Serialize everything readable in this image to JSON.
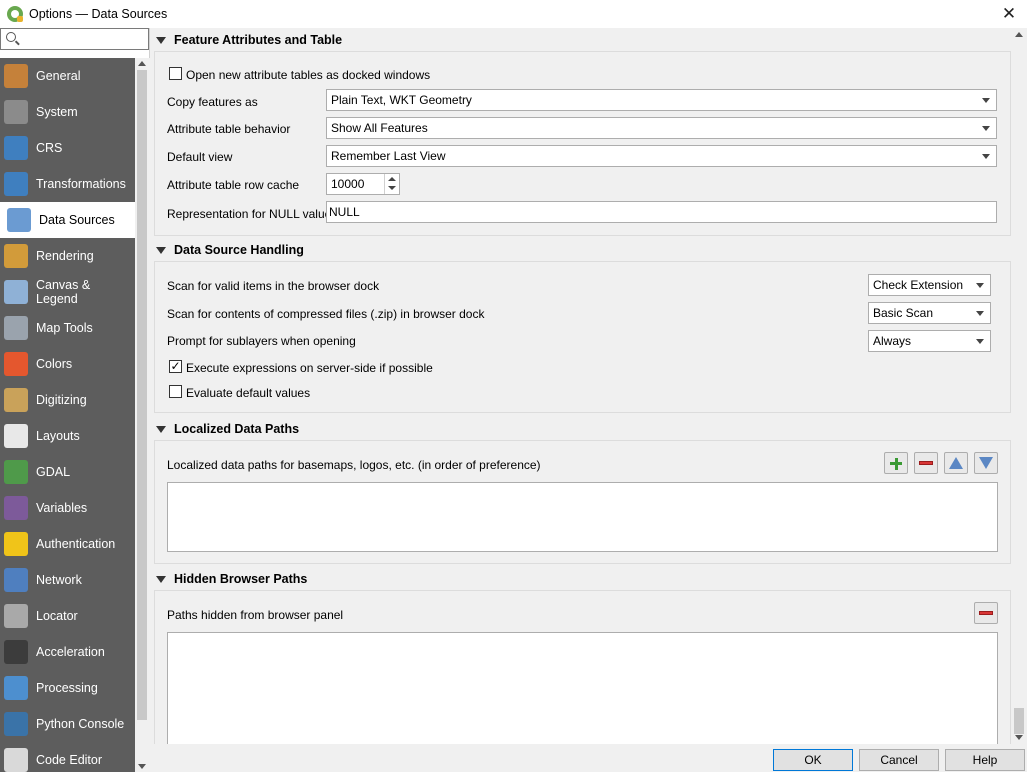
{
  "window": {
    "title": "Options — Data Sources",
    "close_glyph": "✕"
  },
  "search": {
    "value": "",
    "placeholder": ""
  },
  "sidebar": {
    "items": [
      {
        "label": "General",
        "icon": "general-icon",
        "color": "#c5813a"
      },
      {
        "label": "System",
        "icon": "system-icon",
        "color": "#8b8b8b"
      },
      {
        "label": "CRS",
        "icon": "crs-icon",
        "color": "#3f7fbf"
      },
      {
        "label": "Transformations",
        "icon": "transformations-icon",
        "color": "#3f7fbf"
      },
      {
        "label": "Data Sources",
        "icon": "data-sources-icon",
        "color": "#6b9bd2",
        "active": true
      },
      {
        "label": "Rendering",
        "icon": "rendering-icon",
        "color": "#d29b3a"
      },
      {
        "label": "Canvas & Legend",
        "icon": "canvas-legend-icon",
        "color": "#8fb1d6"
      },
      {
        "label": "Map Tools",
        "icon": "map-tools-icon",
        "color": "#9aa3ad"
      },
      {
        "label": "Colors",
        "icon": "colors-icon",
        "color": "#e4572e"
      },
      {
        "label": "Digitizing",
        "icon": "digitizing-icon",
        "color": "#c9a25a"
      },
      {
        "label": "Layouts",
        "icon": "layouts-icon",
        "color": "#e8e8e8"
      },
      {
        "label": "GDAL",
        "icon": "gdal-icon",
        "color": "#4f9a4a"
      },
      {
        "label": "Variables",
        "icon": "variables-icon",
        "color": "#7d5a9a"
      },
      {
        "label": "Authentication",
        "icon": "authentication-icon",
        "color": "#f0c419"
      },
      {
        "label": "Network",
        "icon": "network-icon",
        "color": "#4f7fbf"
      },
      {
        "label": "Locator",
        "icon": "locator-icon",
        "color": "#a9a9a9"
      },
      {
        "label": "Acceleration",
        "icon": "acceleration-icon",
        "color": "#3c3c3c"
      },
      {
        "label": "Processing",
        "icon": "processing-icon",
        "color": "#4d8fcf"
      },
      {
        "label": "Python Console",
        "icon": "python-console-icon",
        "color": "#3a73a8"
      },
      {
        "label": "Code Editor",
        "icon": "code-editor-icon",
        "color": "#d9d9d9"
      }
    ]
  },
  "feature_attributes": {
    "header": "Feature Attributes and Table",
    "open_docked_label": "Open new attribute tables as docked windows",
    "copy_features_label": "Copy features as",
    "copy_features_value": "Plain Text, WKT Geometry",
    "table_behavior_label": "Attribute table behavior",
    "table_behavior_value": "Show All Features",
    "default_view_label": "Default view",
    "default_view_value": "Remember Last View",
    "row_cache_label": "Attribute table row cache",
    "row_cache_value": "10000",
    "null_repr_label": "Representation for NULL values",
    "null_repr_value": "NULL"
  },
  "data_source_handling": {
    "header": "Data Source Handling",
    "scan_valid_label": "Scan for valid items in the browser dock",
    "scan_valid_value": "Check Extension",
    "scan_zip_label": "Scan for contents of compressed files (.zip) in browser dock",
    "scan_zip_value": "Basic Scan",
    "prompt_sublayers_label": "Prompt for sublayers when opening",
    "prompt_sublayers_value": "Always",
    "server_side_label": "Execute expressions on server-side if possible",
    "server_side_checked": "✓",
    "default_values_label": "Evaluate default values"
  },
  "localized_paths": {
    "header": "Localized Data Paths",
    "description": "Localized data paths for basemaps, logos, etc. (in order of preference)"
  },
  "hidden_paths": {
    "header": "Hidden Browser Paths",
    "description": "Paths hidden from browser panel"
  },
  "buttons": {
    "ok": "OK",
    "cancel": "Cancel",
    "help": "Help"
  }
}
